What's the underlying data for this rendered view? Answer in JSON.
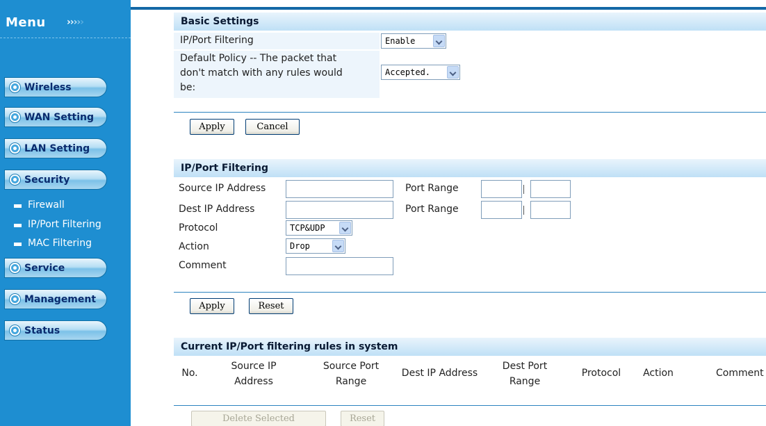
{
  "sidebar": {
    "title": "Menu",
    "arrows": [
      "›",
      "›",
      "›",
      "›",
      "›"
    ],
    "buttons": [
      {
        "label": "Wireless"
      },
      {
        "label": "WAN Setting"
      },
      {
        "label": "LAN Setting"
      },
      {
        "label": "Security"
      },
      {
        "label": "Service"
      },
      {
        "label": "Management"
      },
      {
        "label": "Status"
      }
    ],
    "sub_items": [
      {
        "label": "Firewall"
      },
      {
        "label": "IP/Port Filtering"
      },
      {
        "label": "MAC Filtering"
      }
    ]
  },
  "basic": {
    "heading": "Basic Settings",
    "filtering_label": "IP/Port Filtering",
    "filtering_value": "Enable",
    "policy_label_line1": "Default Policy -- The packet that",
    "policy_label_line2": "don't match with any rules would",
    "policy_label_line3": "be:",
    "policy_value": "Accepted.",
    "apply_label": "Apply",
    "cancel_label": "Cancel"
  },
  "filter": {
    "heading": "IP/Port Filtering",
    "source_ip_label": "Source IP Address",
    "source_port_label": "Port Range",
    "dest_ip_label": "Dest IP Address",
    "dest_port_label": "Port Range",
    "protocol_label": "Protocol",
    "protocol_value": "TCP&UDP",
    "action_label": "Action",
    "action_value": "Drop",
    "comment_label": "Comment",
    "source_ip_value": "",
    "source_port_from": "",
    "source_port_to": "",
    "dest_ip_value": "",
    "dest_port_from": "",
    "dest_port_to": "",
    "comment_value": "",
    "apply_label": "Apply",
    "reset_label": "Reset"
  },
  "rules": {
    "heading": "Current IP/Port filtering rules in system",
    "columns": {
      "no": "No.",
      "source_ip_1": "Source IP",
      "source_ip_2": "Address",
      "source_port_1": "Source Port",
      "source_port_2": "Range",
      "dest_ip": "Dest IP Address",
      "dest_port_1": "Dest Port",
      "dest_port_2": "Range",
      "protocol": "Protocol",
      "action": "Action",
      "comment": "Comment"
    },
    "delete_label": "Delete Selected",
    "reset_label": "Reset"
  }
}
